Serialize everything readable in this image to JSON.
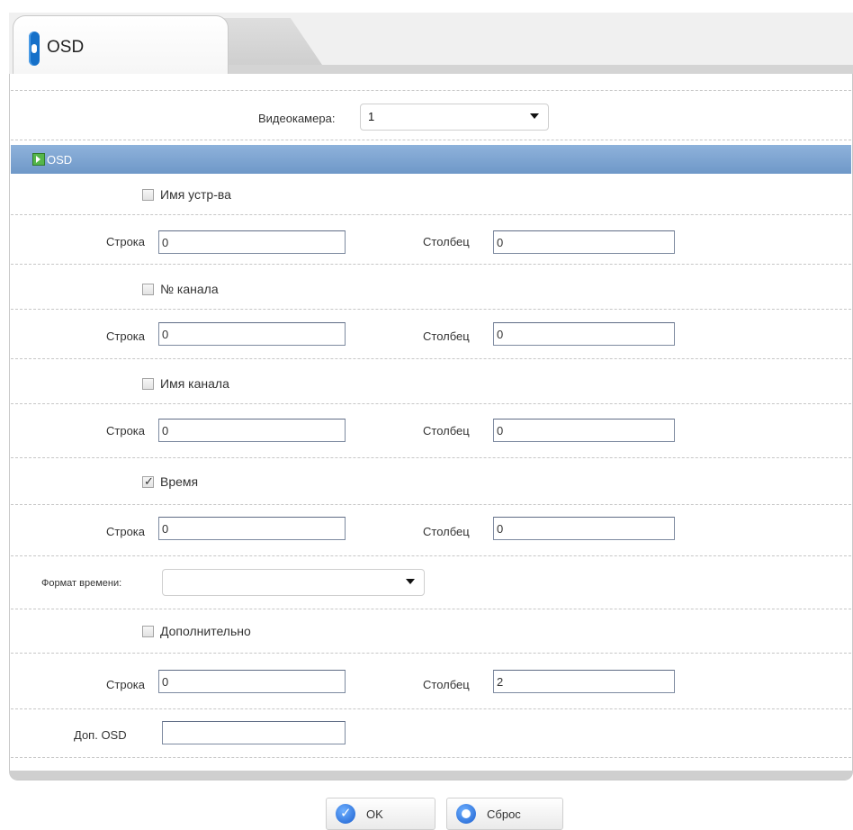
{
  "tab": {
    "label": "OSD"
  },
  "camera": {
    "label": "Видеокамера",
    "value": "1"
  },
  "section": {
    "title": "OSD"
  },
  "items": [
    {
      "checkbox": "Имя устр-ва",
      "checked": false,
      "row_label": "Строка",
      "row_value": "0",
      "col_label": "Столбец",
      "col_value": "0"
    },
    {
      "checkbox": "№ канала",
      "checked": false,
      "row_label": "Строка",
      "row_value": "0",
      "col_label": "Столбец",
      "col_value": "0"
    },
    {
      "checkbox": "Имя канала",
      "checked": false,
      "row_label": "Строка",
      "row_value": "0",
      "col_label": "Столбец",
      "col_value": "0"
    },
    {
      "checkbox": "Время",
      "checked": true,
      "row_label": "Строка",
      "row_value": "0",
      "col_label": "Столбец",
      "col_value": "0"
    }
  ],
  "time_format": {
    "label": "Формат времени",
    "value": ""
  },
  "extra": {
    "checkbox": "Дополнительно",
    "checked": false,
    "row_label": "Строка",
    "row_value": "0",
    "col_label": "Столбец",
    "col_value": "2"
  },
  "extra_osd": {
    "label": "Доп. OSD",
    "value": ""
  },
  "buttons": {
    "ok": "OK",
    "reset": "Сброс"
  }
}
